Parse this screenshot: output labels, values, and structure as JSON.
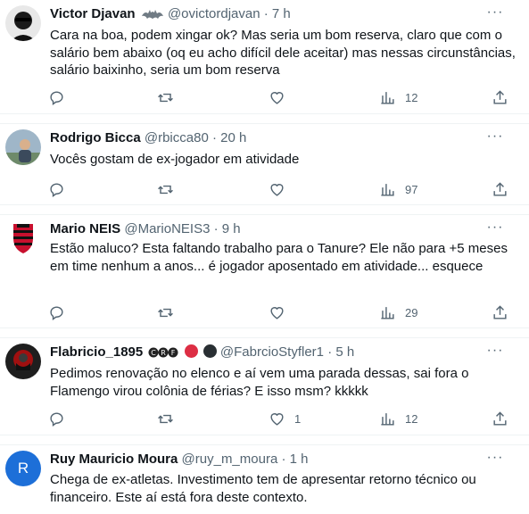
{
  "tweets": [
    {
      "name": "Victor Djavan",
      "handle": "@ovictordjavan",
      "dot": "·",
      "time": "7 h",
      "text": "Cara na boa, podem xingar ok? Mas seria um bom reserva, claro que com o salário bem abaixo (oq eu acho difícil dele aceitar) mas nessas circunstâncias, salário baixinho, seria um bom reserva",
      "replies": "",
      "retweets": "",
      "likes": "",
      "views": "12"
    },
    {
      "name": "Rodrigo Bicca",
      "handle": "@rbicca80",
      "dot": "·",
      "time": "20 h",
      "text": "Vocês gostam de ex-jogador em atividade",
      "replies": "",
      "retweets": "",
      "likes": "",
      "views": "97"
    },
    {
      "name": "Mario NEIS",
      "handle": "@MarioNEIS3",
      "dot": "·",
      "time": "9 h",
      "text": "Estão maluco? Esta faltando trabalho para o Tanure? Ele não para +5 meses em time nenhum a anos... é jogador aposentado em atividade... esquece",
      "replies": "",
      "retweets": "",
      "likes": "",
      "views": "29"
    },
    {
      "name": "Flabricio_1895",
      "handle": "@FabrcioStyfler1",
      "dot": "·",
      "time": "5 h",
      "text": "Pedimos renovação no elenco e aí  vem uma parada dessas, sai fora o Flamengo virou colônia de férias? E isso msm? kkkkk",
      "replies": "",
      "retweets": "",
      "likes": "1",
      "views": "12"
    },
    {
      "name": "Ruy Mauricio Moura",
      "handle": "@ruy_m_moura",
      "dot": "·",
      "time": "1 h",
      "text": "Chega de ex-atletas. Investimento tem de apresentar retorno técnico ou financeiro. Este aí está fora deste contexto.",
      "avatar_letter": "R"
    }
  ],
  "more_label": "···",
  "colors": {
    "text": "#0f1419",
    "secondary": "#536471",
    "border": "#eff3f4",
    "flamengo_red": "#c8102e",
    "avatar_blue": "#1d6fd8"
  }
}
